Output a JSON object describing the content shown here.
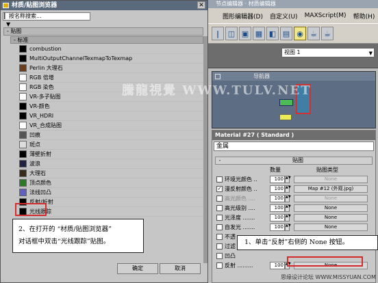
{
  "bg_app": {
    "title": "节点编辑器 · 材质编辑器",
    "menu": [
      "图形编辑器(D)",
      "自定义(U)",
      "MAXScript(M)",
      "帮助(H)"
    ],
    "viewport_select": "视图 1",
    "nav_title": "导航器"
  },
  "material": {
    "title": "Material #27  ( Standard )",
    "name": "金属",
    "rollout_title": "贴图",
    "rollout_toggle": "-",
    "col_amount": "数量",
    "col_maptype": "贴图类型",
    "rows": [
      {
        "checked": false,
        "label": "环境光颜色 ..",
        "dim": false,
        "amount": "100",
        "map": "None",
        "map_dim": true
      },
      {
        "checked": true,
        "label": "漫反射颜色 ..",
        "dim": false,
        "amount": "100",
        "map": "Map #12 (外观.jpg)",
        "map_dim": false
      },
      {
        "checked": false,
        "label": "高光颜色 ....",
        "dim": true,
        "amount": "100",
        "map": "None",
        "map_dim": true
      },
      {
        "checked": false,
        "label": "高光级别 ....",
        "dim": false,
        "amount": "100",
        "map": "None",
        "map_dim": false
      },
      {
        "checked": false,
        "label": "光泽度 .......",
        "dim": false,
        "amount": "100",
        "map": "None",
        "map_dim": false
      },
      {
        "checked": false,
        "label": "自发光 .......",
        "dim": false,
        "amount": "100",
        "map": "None",
        "map_dim": false
      },
      {
        "checked": false,
        "label": "不透",
        "dim": false,
        "amount": "",
        "map": "",
        "map_dim": false
      },
      {
        "checked": false,
        "label": "过滤",
        "dim": false,
        "amount": "",
        "map": "",
        "map_dim": false
      },
      {
        "checked": false,
        "label": "凹凸",
        "dim": false,
        "amount": "",
        "map": "",
        "map_dim": false
      },
      {
        "checked": false,
        "label": "反射 .........",
        "dim": false,
        "amount": "100",
        "map": "None",
        "map_dim": false
      }
    ]
  },
  "callout_right": "1、单击“反射”右侧的 None 按钮。",
  "dialog": {
    "title": "材质/贴图浏览器",
    "close": "✕",
    "search_placeholder": "按名称搜索...",
    "arrow": "▼",
    "tree_head": "- 贴图",
    "category": "- 标准",
    "ok": "确定",
    "cancel": "取消",
    "maps": [
      {
        "name": "combustion",
        "swatch": "#000000"
      },
      {
        "name": "MultiOutputChannelTexmapToTexmap",
        "swatch": "#000000"
      },
      {
        "name": "Perlin 大理石",
        "swatch": "#6b3d1a"
      },
      {
        "name": "RGB 倍增",
        "swatch": "#ffffff"
      },
      {
        "name": "RGB 染色",
        "swatch": "#ffffff"
      },
      {
        "name": "VR-多子贴图",
        "swatch": "#ffffff"
      },
      {
        "name": "VR-颜色",
        "swatch": "#000000"
      },
      {
        "name": "VR_HDRI",
        "swatch": "#000000"
      },
      {
        "name": "VR_合成贴图",
        "swatch": "#ffffff"
      },
      {
        "name": "凹痕",
        "swatch": "#555555"
      },
      {
        "name": "斑点",
        "swatch": "#dddddd"
      },
      {
        "name": "薄壁折射",
        "swatch": "#000000"
      },
      {
        "name": "波浪",
        "swatch": "#222244"
      },
      {
        "name": "大理石",
        "swatch": "#3a2a1a"
      },
      {
        "name": "顶点颜色",
        "swatch": "#2a7a2a"
      },
      {
        "name": "法线凹凸",
        "swatch": "#6060c0"
      },
      {
        "name": "反射/折射",
        "swatch": "#000000"
      },
      {
        "name": "光线跟踪",
        "swatch": "#000000"
      }
    ]
  },
  "callout_left": [
    "2、在打开的 “材质/贴图浏览器”",
    "对话框中双击“光线跟踪”贴图。"
  ],
  "watermarks": {
    "main": "騰龍視覺 WWW.TULV.NET",
    "bottom": "思缘设计论坛 WWW.MISSYUAN.COM"
  }
}
